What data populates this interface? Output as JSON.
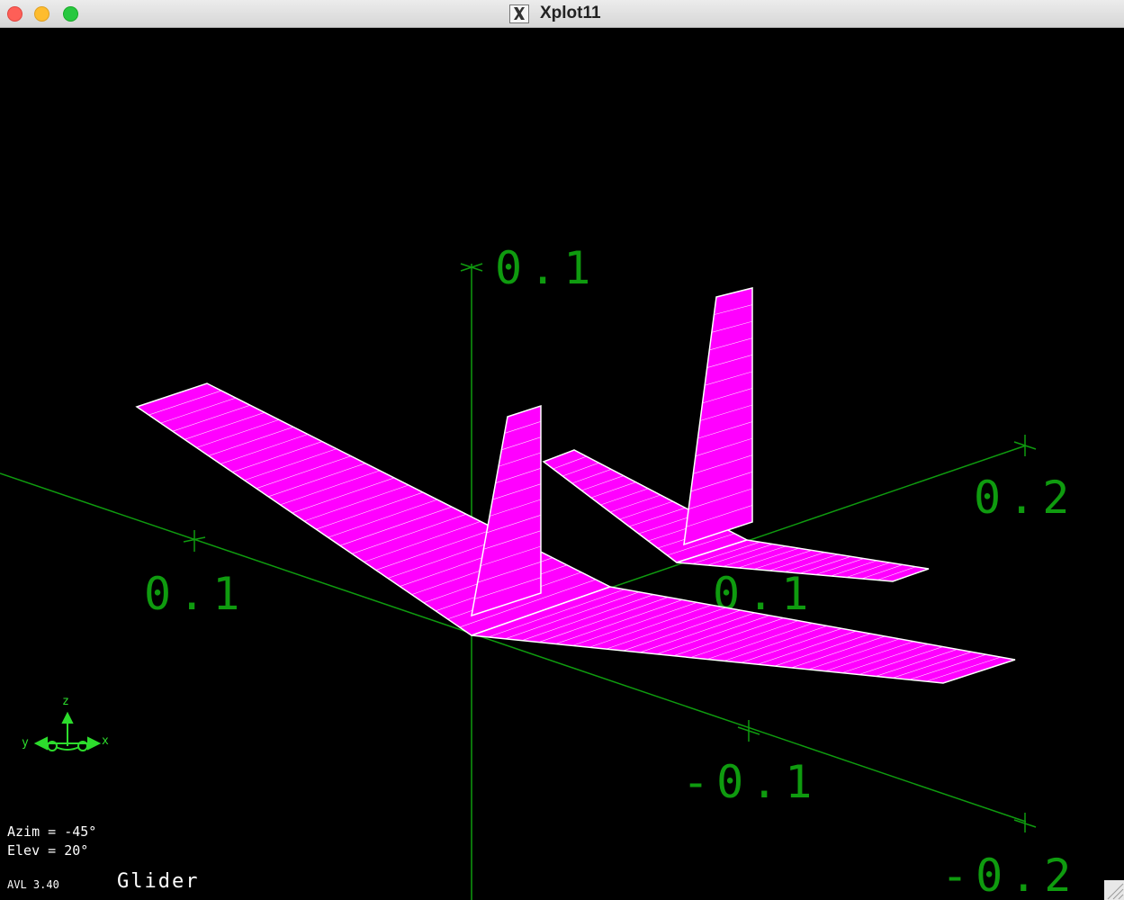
{
  "window": {
    "title": "Xplot11",
    "controls": [
      "close",
      "minimize",
      "maximize"
    ]
  },
  "plot": {
    "axis_labels": {
      "z_top": "0.1",
      "x_positive": "0.1",
      "y_positive": "0.2",
      "y_mid": "0.1",
      "y_negative": "-0.1",
      "x_negative": "-0.2"
    },
    "triad": {
      "z": "z",
      "y": "y",
      "x": "x"
    },
    "view": {
      "azim": "Azim = -45°",
      "elev": "Elev = 20°"
    },
    "version": "AVL 3.40",
    "config_name": "Glider",
    "colors": {
      "background": "#000000",
      "axes": "#0f9b0f",
      "surface_fill": "#ff00ff",
      "panel_lines": "#ffffff",
      "text": "#ffffff"
    }
  }
}
